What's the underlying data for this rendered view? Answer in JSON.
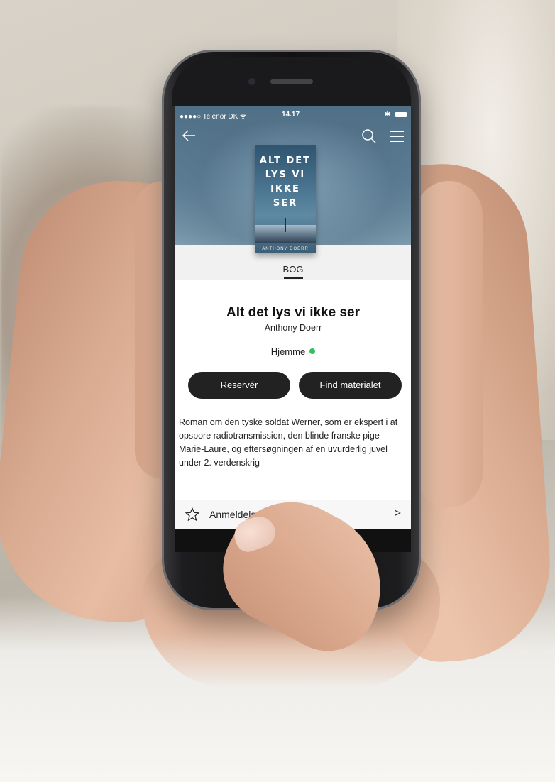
{
  "statusbar": {
    "carrier": "●●●●○ Telenor DK ᯤ",
    "time": "14.17",
    "right": "✱"
  },
  "nav": {
    "back_icon": "arrow-left-icon",
    "search_icon": "search-icon",
    "menu_icon": "hamburger-menu-icon"
  },
  "cover": {
    "title_lines": [
      "ALT DET",
      "LYS VI",
      "IKKE",
      "SER"
    ],
    "author": "ANTHONY DOERR"
  },
  "tab": {
    "label": "BOG"
  },
  "book": {
    "title": "Alt det lys vi ikke ser",
    "author": "Anthony Doerr",
    "availability": "Hjemme",
    "availability_color": "#2ec25b",
    "description": "Roman om den tyske soldat Werner, som er ekspert i at opspore radiotransmission, den blinde franske pige Marie-Laure, og eftersøgningen af en uvurderlig juvel under 2. verdenskrig"
  },
  "actions": {
    "reserve_label": "Reservér",
    "find_label": "Find materialet"
  },
  "reviews": {
    "label": "Anmeldelser",
    "icon": "star-outline-icon",
    "chevron": ">"
  }
}
